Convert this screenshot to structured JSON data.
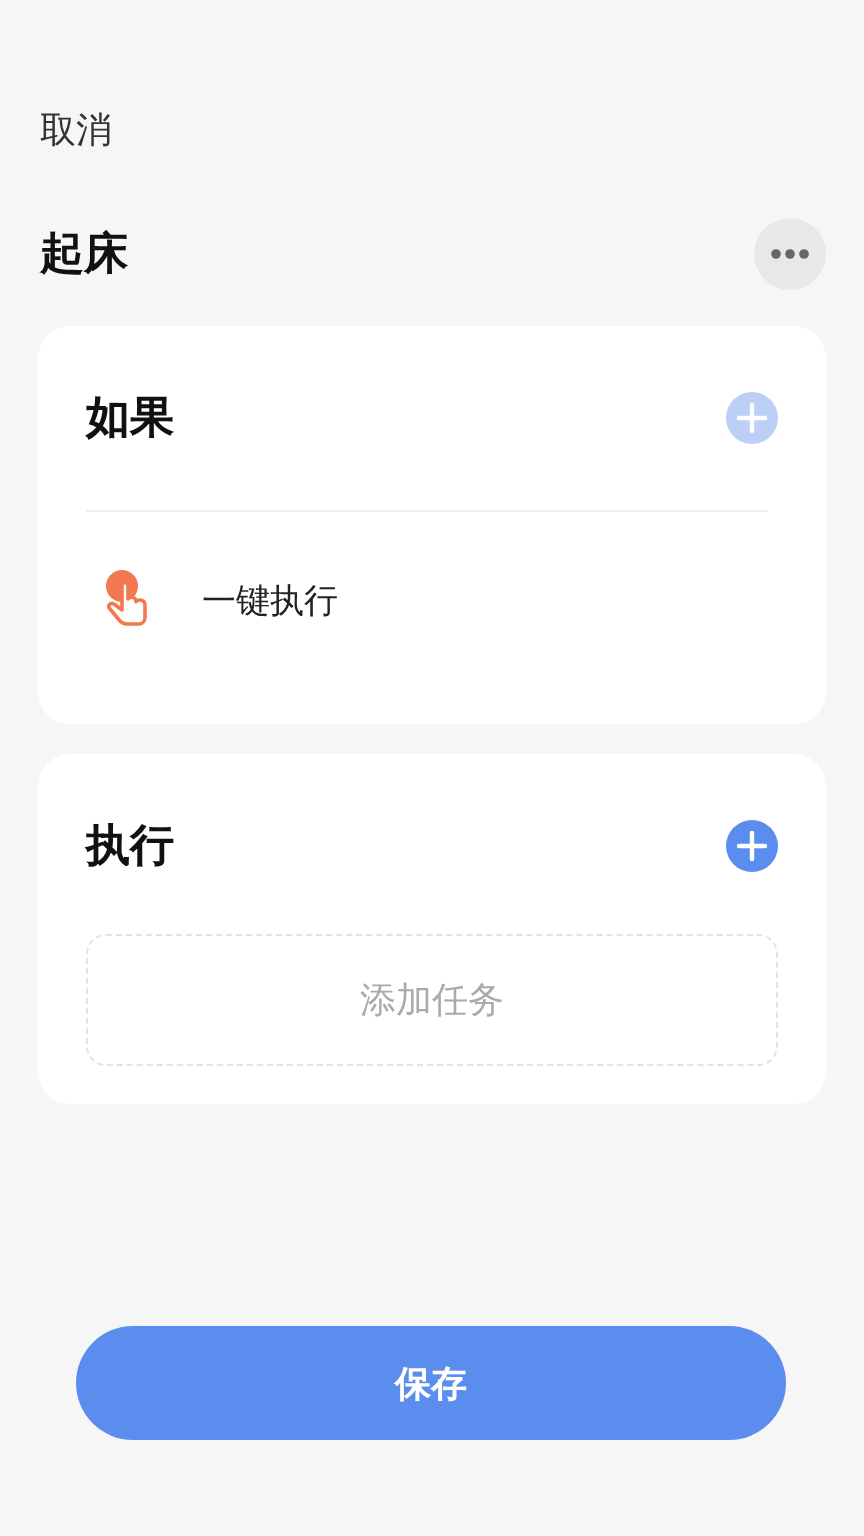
{
  "header": {
    "cancel": "取消",
    "title": "起床"
  },
  "sections": [
    {
      "kind": "trigger",
      "title": "如果",
      "add_disabled": true,
      "items": [
        {
          "label": "一键执行"
        }
      ]
    },
    {
      "kind": "action",
      "title": "执行",
      "add_disabled": false,
      "add_task": "添加任务"
    }
  ],
  "save": "保存"
}
